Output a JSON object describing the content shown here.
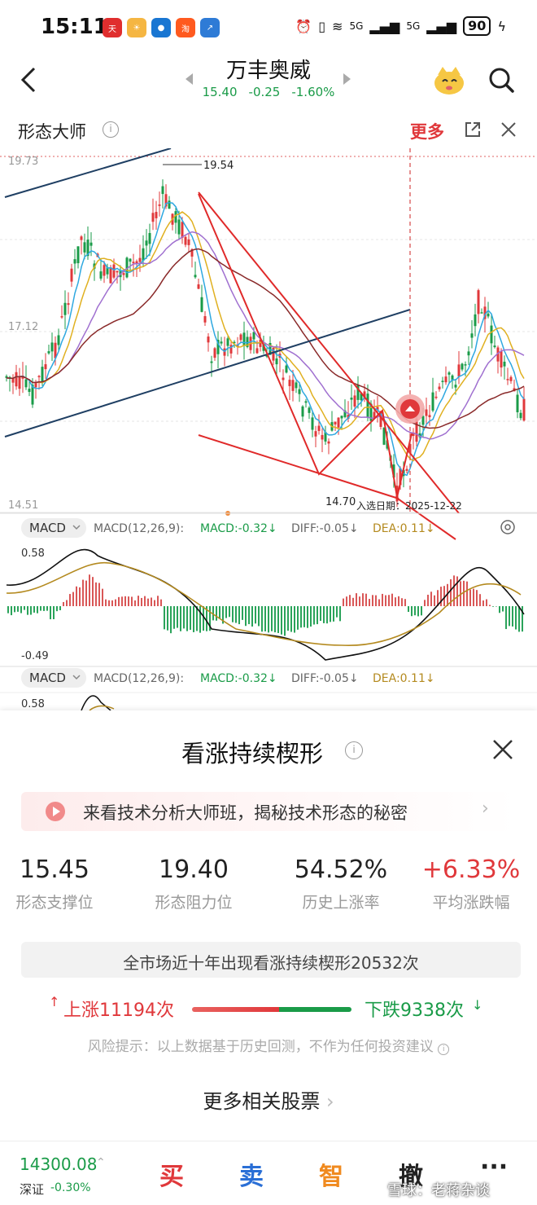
{
  "status_bar": {
    "time": "15:11",
    "network_1": "5G",
    "network_2": "5G",
    "battery": "90"
  },
  "header": {
    "stock_name": "万丰奥威",
    "price": "15.40",
    "change": "-0.25",
    "change_pct": "-1.60%"
  },
  "pattern_bar": {
    "title": "形态大师",
    "more": "更多"
  },
  "chart": {
    "price_labels": {
      "top": "19.73",
      "mid": "17.12",
      "bottom": "14.51",
      "high_marker": "19.54",
      "low_marker": "14.70"
    },
    "entry_label": "入选日期：2025-12-22",
    "macd_panel_1": {
      "indicator": "MACD",
      "params": "MACD(12,26,9):",
      "macd": "MACD:-0.32↓",
      "diff": "DIFF:-0.05↓",
      "dea": "DEA:0.11↓",
      "max": "0.58",
      "min": "-0.49"
    },
    "macd_panel_2": {
      "indicator": "MACD",
      "params": "MACD(12,26,9):",
      "macd": "MACD:-0.32↓",
      "diff": "DIFF:-0.05↓",
      "dea": "DEA:0.11↓",
      "max": "0.58"
    }
  },
  "panel": {
    "title": "看涨持续楔形",
    "promo": "来看技术分析大师班，揭秘技术形态的秘密",
    "stats": [
      {
        "value": "15.45",
        "label": "形态支撑位"
      },
      {
        "value": "19.40",
        "label": "形态阻力位"
      },
      {
        "value": "54.52%",
        "label": "历史上涨率"
      },
      {
        "value": "+6.33%",
        "label": "平均涨跌幅"
      }
    ],
    "occurrence": "全市场近十年出现看涨持续楔形20532次",
    "up": "上涨11194次",
    "down": "下跌9338次",
    "up_ratio": 0.545,
    "risk": "风险提示：以上数据基于历史回测，不作为任何投资建议",
    "more_stocks": "更多相关股票"
  },
  "bottom_bar": {
    "index_value": "14300.08",
    "index_name": "深证",
    "index_change": "-0.30%",
    "buy": "买",
    "sell": "卖",
    "smart": "智",
    "cancel": "撤",
    "more": "···",
    "watermark": "雪球：老蒋杂谈"
  },
  "colors": {
    "up_red": "#e0383b",
    "down_green": "#1a9b48",
    "trend_blue": "#1f3f63"
  }
}
